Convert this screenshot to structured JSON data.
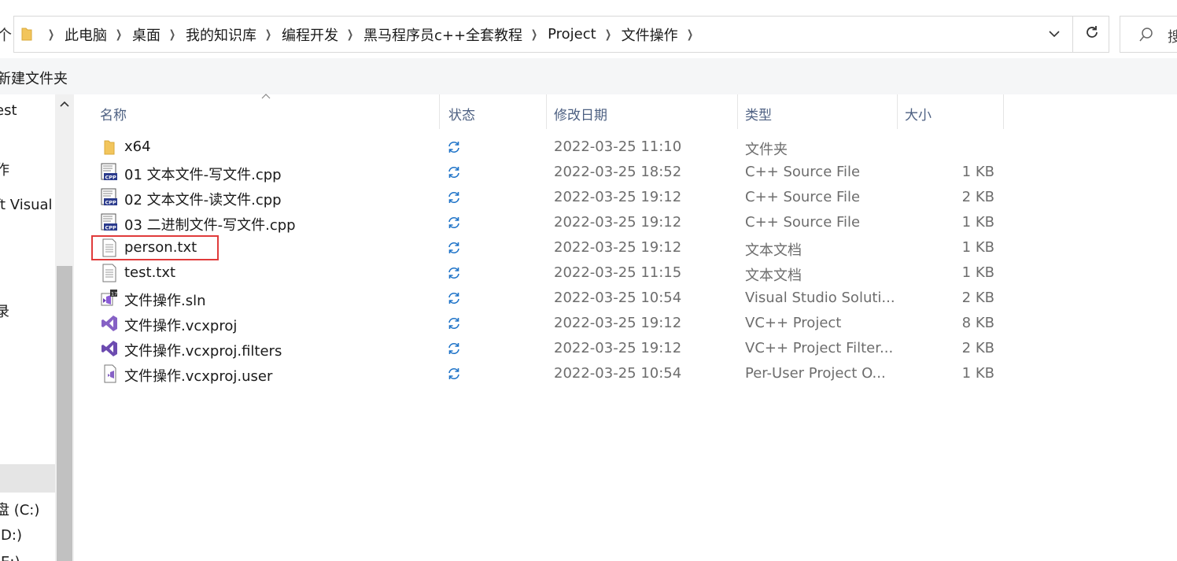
{
  "address_bar": {
    "up_glyph": "个",
    "crumbs": [
      "此电脑",
      "桌面",
      "我的知识库",
      "编程开发",
      "黑马程序员c++全套教程",
      "Project",
      "文件操作"
    ],
    "search_placeholder": "搜"
  },
  "toolbar": {
    "new_folder_label": "新建文件夹"
  },
  "nav": {
    "items": [
      "est",
      "作",
      "ft Visual",
      "录",
      "盘 (C:)",
      "(D:)",
      "(E:)"
    ]
  },
  "columns": {
    "name": "名称",
    "status": "状态",
    "modified": "修改日期",
    "type": "类型",
    "size": "大小"
  },
  "files": [
    {
      "icon": "folder-icon",
      "name": "x64",
      "modified": "2022-03-25 11:10",
      "type": "文件夹",
      "size": ""
    },
    {
      "icon": "cpp-file-icon",
      "name": "01 文本文件-写文件.cpp",
      "modified": "2022-03-25 18:52",
      "type": "C++ Source File",
      "size": "1 KB"
    },
    {
      "icon": "cpp-file-icon",
      "name": "02 文本文件-读文件.cpp",
      "modified": "2022-03-25 19:12",
      "type": "C++ Source File",
      "size": "2 KB"
    },
    {
      "icon": "cpp-file-icon",
      "name": "03 二进制文件-写文件.cpp",
      "modified": "2022-03-25 19:12",
      "type": "C++ Source File",
      "size": "1 KB"
    },
    {
      "icon": "text-file-icon",
      "name": "person.txt",
      "modified": "2022-03-25 19:12",
      "type": "文本文档",
      "size": "1 KB"
    },
    {
      "icon": "text-file-icon",
      "name": "test.txt",
      "modified": "2022-03-25 11:15",
      "type": "文本文档",
      "size": "1 KB"
    },
    {
      "icon": "vs-solution-icon",
      "name": "文件操作.sln",
      "modified": "2022-03-25 10:54",
      "type": "Visual Studio Soluti...",
      "size": "2 KB"
    },
    {
      "icon": "vcxproj-icon",
      "name": "文件操作.vcxproj",
      "modified": "2022-03-25 19:12",
      "type": "VC++ Project",
      "size": "8 KB"
    },
    {
      "icon": "vcxproj-filters-icon",
      "name": "文件操作.vcxproj.filters",
      "modified": "2022-03-25 19:12",
      "type": "VC++ Project Filter...",
      "size": "2 KB"
    },
    {
      "icon": "vcxproj-user-icon",
      "name": "文件操作.vcxproj.user",
      "modified": "2022-03-25 10:54",
      "type": "Per-User Project O...",
      "size": "1 KB"
    }
  ],
  "highlighted_file": "person.txt",
  "colors": {
    "highlight_border": "#e03b3b",
    "sync_icon": "#1e73c8",
    "header_text": "#4d6082"
  }
}
